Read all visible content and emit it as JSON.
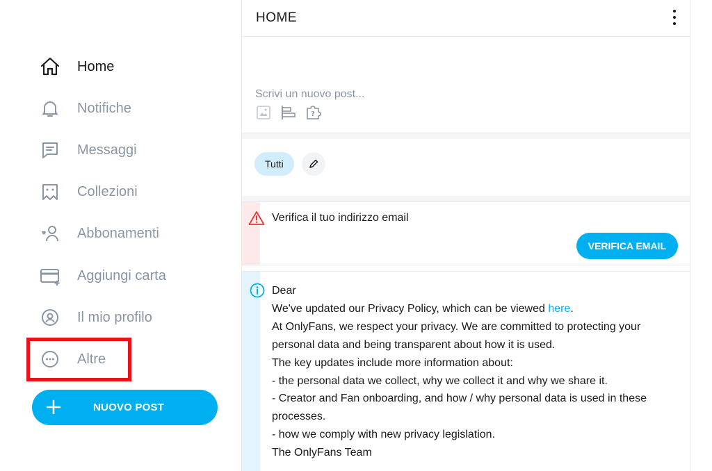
{
  "sidebar": {
    "items": [
      {
        "label": "Home",
        "icon": "home-icon",
        "active": true
      },
      {
        "label": "Notifiche",
        "icon": "bell-icon"
      },
      {
        "label": "Messaggi",
        "icon": "message-icon"
      },
      {
        "label": "Collezioni",
        "icon": "collections-icon"
      },
      {
        "label": "Abbonamenti",
        "icon": "subscriptions-icon"
      },
      {
        "label": "Aggiungi carta",
        "icon": "add-card-icon"
      },
      {
        "label": "Il mio profilo",
        "icon": "profile-icon"
      },
      {
        "label": "Altre",
        "icon": "more-circle-icon"
      }
    ],
    "new_post_label": "NUOVO POST",
    "highlight_color": "#e8141b"
  },
  "header": {
    "title": "HOME"
  },
  "composer": {
    "placeholder": "Scrivi un nuovo post...",
    "tools": [
      "image-icon",
      "poll-icon",
      "quiz-icon"
    ]
  },
  "filters": {
    "chip_label": "Tutti"
  },
  "email_alert": {
    "message": "Verifica il tuo indirizzo email",
    "button_label": "VERIFICA EMAIL"
  },
  "notice": {
    "greeting": "Dear",
    "policy_text": "We've updated our Privacy Policy, which can be viewed ",
    "policy_link": "here",
    "policy_end": ".",
    "lines": [
      "At OnlyFans, we respect your privacy. We are committed to protecting your",
      "personal data and being transparent about how it is used.",
      "The key updates include more information about:",
      "- the personal data we collect, why we collect it and why we share it.",
      "- Creator and Fan onboarding, and how / why personal data is used in these",
      "processes.",
      "- how we comply with new privacy legislation.",
      "The OnlyFans Team"
    ]
  },
  "colors": {
    "accent": "#00aff0",
    "muted_text": "#8a96a3",
    "warning": "#e53935",
    "info": "#00aff0"
  }
}
